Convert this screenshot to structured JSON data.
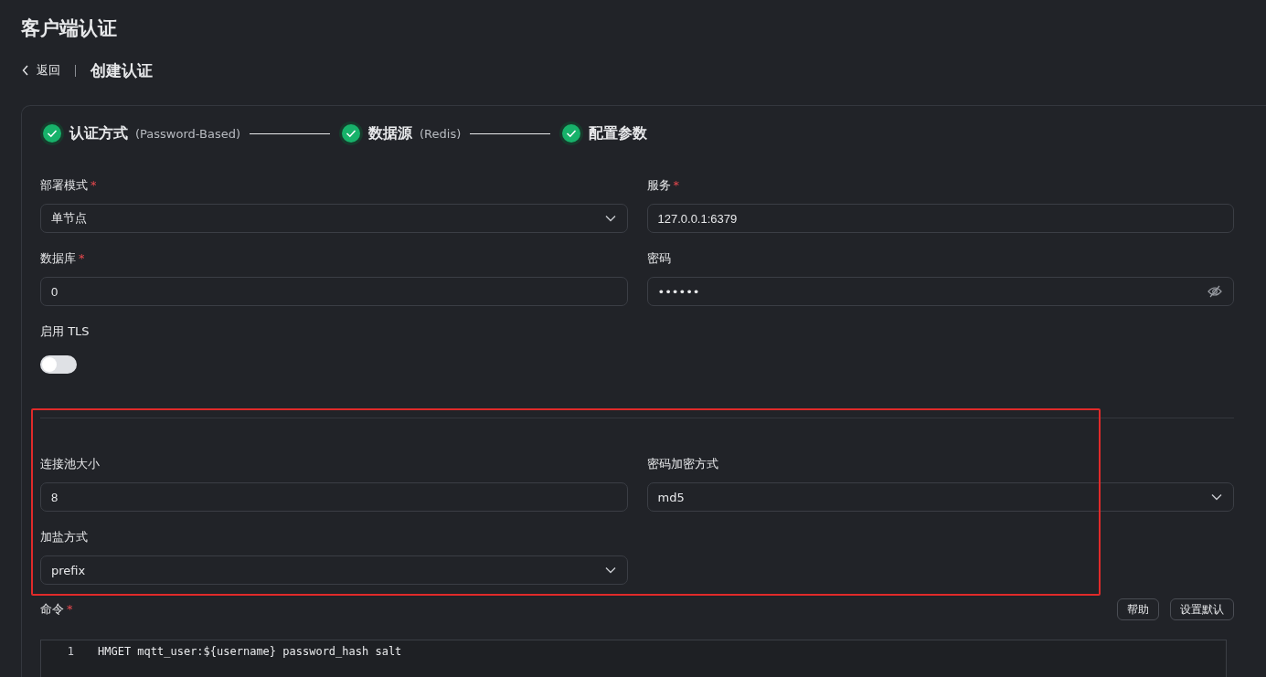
{
  "page_title": "客户端认证",
  "breadcrumb": {
    "back": "返回",
    "current": "创建认证"
  },
  "steps": [
    {
      "label": "认证方式",
      "detail": "(Password-Based)",
      "done": true
    },
    {
      "label": "数据源",
      "detail": "(Redis)",
      "done": true
    },
    {
      "label": "配置参数",
      "done": true
    }
  ],
  "fields": [
    {
      "label": "部署模式",
      "required_mark": "*",
      "kind": "select",
      "value": "单节点"
    },
    {
      "label": "服务",
      "required_mark": "*",
      "kind": "input",
      "value": "127.0.0.1:6379"
    },
    {
      "label": "数据库",
      "required_mark": "*",
      "kind": "input",
      "value": "0"
    },
    {
      "label": "密码",
      "kind": "password",
      "value": "••••••"
    },
    {
      "label": "启用 TLS",
      "kind": "switch",
      "on": false
    }
  ],
  "advanced_fields": [
    {
      "label": "连接池大小",
      "kind": "input",
      "value": "8"
    },
    {
      "label": "密码加密方式",
      "kind": "select",
      "value": "md5"
    },
    {
      "label": "加盐方式",
      "kind": "select",
      "value": "prefix"
    }
  ],
  "command": {
    "label": "命令",
    "required_mark": "*",
    "buttons": [
      "帮助",
      "设置默认"
    ],
    "lines": [
      {
        "number": "1",
        "code": "HMGET mqtt_user:${username} password_hash salt"
      }
    ]
  }
}
